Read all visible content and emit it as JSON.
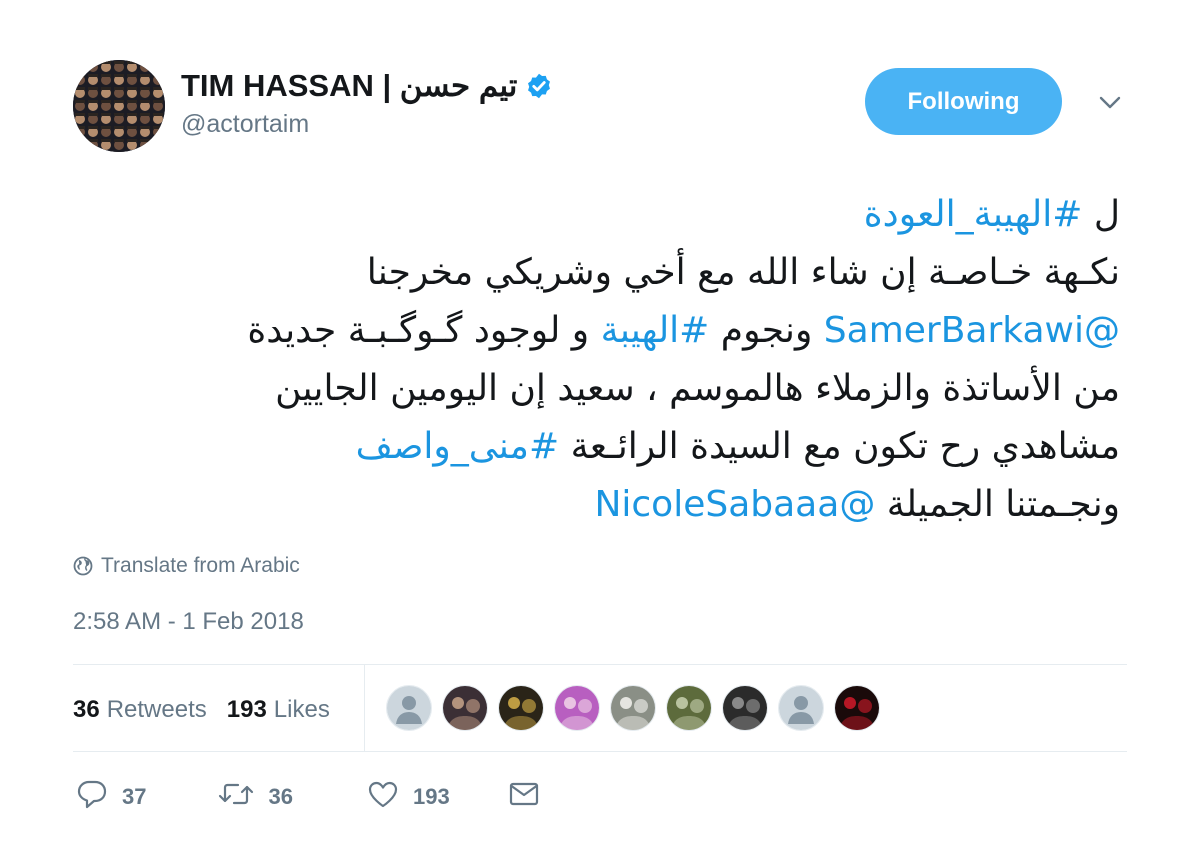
{
  "header": {
    "display_name": "تيم حسن | TIM HASSAN",
    "handle": "@actortaim",
    "follow_label": "Following"
  },
  "tweet": {
    "lines": [
      [
        {
          "t": "ل  "
        },
        {
          "t": "#الهيبة_العودة",
          "link": true
        }
      ],
      [
        {
          "t": "نكـهة خـاصـة إن شاء الله مع  أخي وشريكي مخرجنا"
        }
      ],
      [
        {
          "t": "@SamerBarkawi",
          "link": true
        },
        {
          "t": " ونجوم "
        },
        {
          "t": "#الهيبة",
          "link": true
        },
        {
          "t": "  و لوجود گـوگـبـة جديدة"
        }
      ],
      [
        {
          "t": "من الأساتذة والزملاء هالموسم ،  سعيد إن  اليومين الجايين"
        }
      ],
      [
        {
          "t": "مشاهدي رح تكون مع السيدة الرائـعة "
        },
        {
          "t": "#منى_واصف",
          "link": true
        }
      ],
      [
        {
          "t": "ونجـمتنا الجميلة  "
        },
        {
          "t": "@NicoleSabaaa",
          "link": true
        }
      ]
    ],
    "translate_label": "Translate from Arabic",
    "timestamp": "2:58 AM - 1 Feb 2018"
  },
  "stats": {
    "retweets_count": "36",
    "retweets_label": "Retweets",
    "likes_count": "193",
    "likes_label": "Likes"
  },
  "likers": [
    {
      "kind": "default"
    },
    {
      "kind": "photo",
      "bg": "#3b2f35",
      "fg": "#c9a48a"
    },
    {
      "kind": "photo",
      "bg": "#2a2418",
      "fg": "#d8b24a"
    },
    {
      "kind": "photo",
      "bg": "#b85fc0",
      "fg": "#f1d6e8"
    },
    {
      "kind": "photo",
      "bg": "#8a8f86",
      "fg": "#f4f4f0"
    },
    {
      "kind": "photo",
      "bg": "#5d6b3c",
      "fg": "#c9d2b0"
    },
    {
      "kind": "photo",
      "bg": "#2b2b2b",
      "fg": "#9a9a9a"
    },
    {
      "kind": "default"
    },
    {
      "kind": "photo",
      "bg": "#1a0a0a",
      "fg": "#d21a2a"
    }
  ],
  "actions": {
    "reply_count": "37",
    "retweet_count": "36",
    "like_count": "193"
  },
  "colors": {
    "accent": "#1b95e0",
    "button": "#4ab3f4",
    "muted": "#657786",
    "verified": "#1da1f2"
  }
}
